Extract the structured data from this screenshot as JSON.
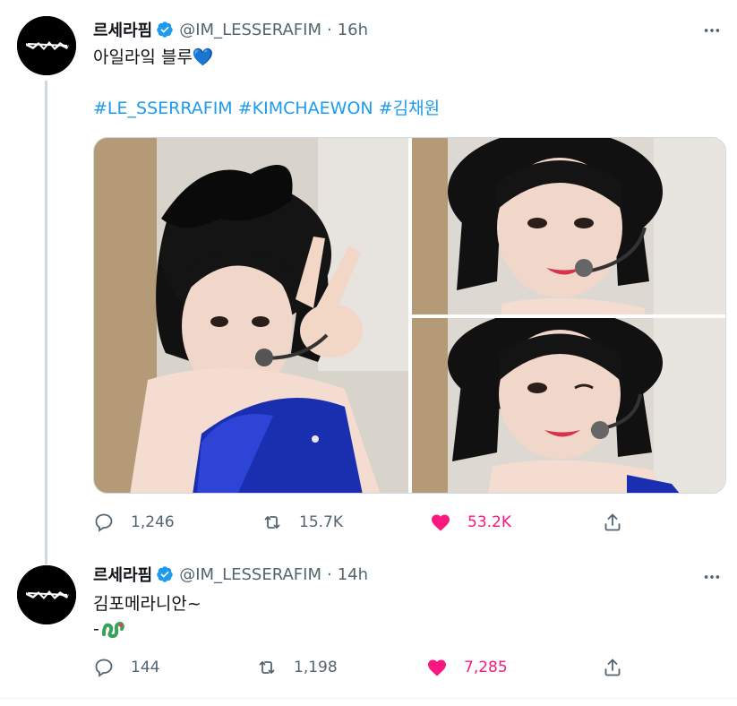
{
  "tweets": [
    {
      "display_name": "르세라핌",
      "handle": "@IM_LESSERAFIM",
      "separator": "·",
      "time": "16h",
      "text_line1": "아일라잌 블루",
      "text_line1_emoji": "💙",
      "hashtags": [
        "#LE_SSERRAFIM",
        "#KIMCHAEWON",
        "#김채원"
      ],
      "stats": {
        "replies": "1,246",
        "retweets": "15.7K",
        "likes": "53.2K"
      },
      "liked": true
    },
    {
      "display_name": "르세라핌",
      "handle": "@IM_LESSERAFIM",
      "separator": "·",
      "time": "14h",
      "text_line1": "김포메라니안~",
      "text_line2": "-",
      "stats": {
        "replies": "144",
        "retweets": "1,198",
        "likes": "7,285"
      },
      "liked": true
    }
  ],
  "icons": {
    "verified": "verified-badge-icon",
    "more": "more-options-icon",
    "reply": "reply-icon",
    "retweet": "retweet-icon",
    "like": "like-heart-icon",
    "share": "share-icon"
  },
  "colors": {
    "accent": "#1d9bf0",
    "like": "#f91880",
    "muted": "#536471",
    "dress_blue": "#1a2fb0"
  }
}
